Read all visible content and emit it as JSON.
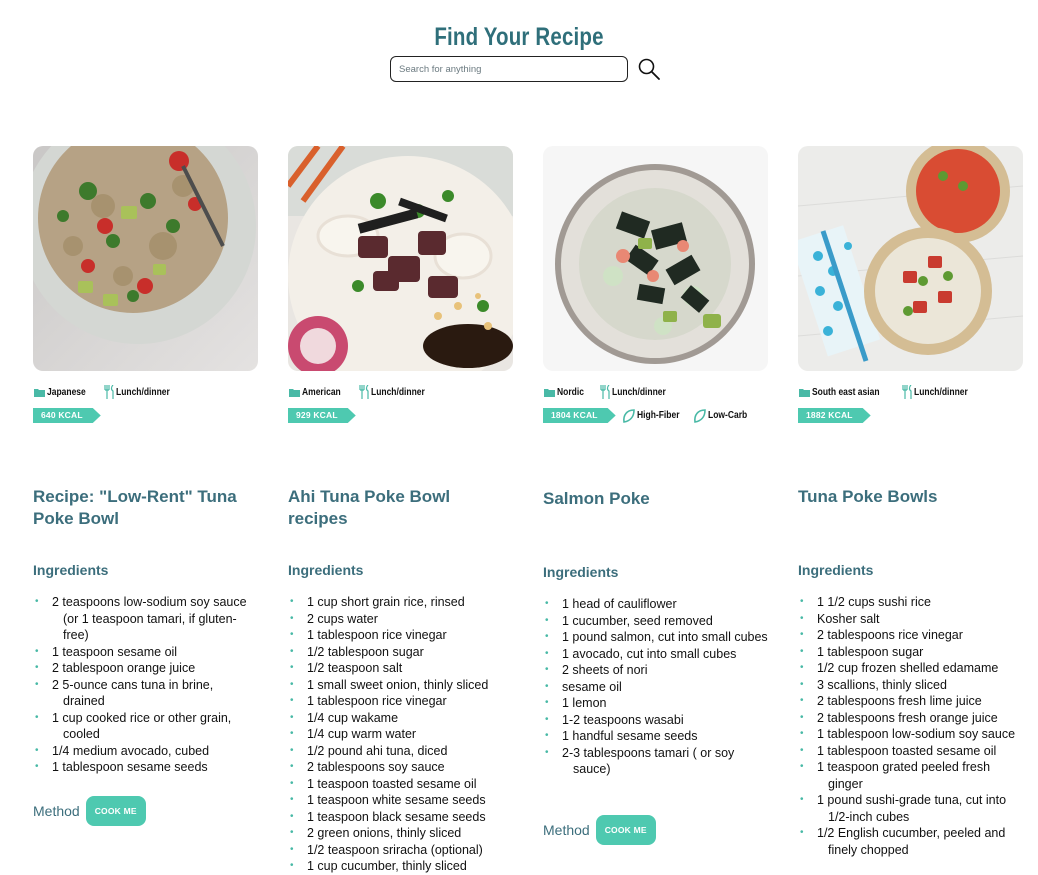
{
  "header": {
    "title": "Find Your Recipe"
  },
  "search": {
    "placeholder": "Search for anything"
  },
  "labels": {
    "ingredients": "Ingredients",
    "method": "Method",
    "cook_button": "COOK ME"
  },
  "colors": {
    "accent": "#4ec9b0",
    "heading": "#3c6e7c",
    "title": "#2f6f7a"
  },
  "recipes": [
    {
      "cuisine": "Japanese",
      "meal": "Lunch/dinner",
      "kcal": "640 KCAL",
      "diet": [],
      "title": "Recipe: \"Low-Rent\" Tuna Poke Bowl",
      "ingredients": [
        "2 teaspoons low-sodium soy sauce (or 1 teaspoon tamari, if gluten-free)",
        "1 teaspoon sesame oil",
        "2 tablespoon orange juice",
        "2 5-ounce cans tuna in brine, drained",
        "1 cup cooked rice or other grain, cooled",
        "1/4 medium avocado, cubed",
        "1 tablespoon sesame seeds"
      ]
    },
    {
      "cuisine": "American",
      "meal": "Lunch/dinner",
      "kcal": "929 KCAL",
      "diet": [],
      "title": "Ahi Tuna Poke Bowl recipes",
      "ingredients": [
        "1 cup short grain rice, rinsed",
        "2 cups water",
        "1 tablespoon rice vinegar",
        "1/2 tablespoon sugar",
        "1/2 teaspoon salt",
        "1 small sweet onion, thinly sliced",
        "1 tablespoon rice vinegar",
        "1/4 cup wakame",
        "1/4 cup warm water",
        "1/2 pound ahi tuna, diced",
        "2 tablespoons soy sauce",
        "1 teaspoon toasted sesame oil",
        "1 teaspoon white sesame seeds",
        "1 teaspoon black sesame seeds",
        "2 green onions, thinly sliced",
        "1/2 teaspoon sriracha (optional)",
        "1 cup cucumber, thinly sliced"
      ]
    },
    {
      "cuisine": "Nordic",
      "meal": "Lunch/dinner",
      "kcal": "1804 KCAL",
      "diet": [
        "High-Fiber",
        "Low-Carb"
      ],
      "title": "Salmon Poke",
      "ingredients": [
        "1 head of cauliflower",
        "1 cucumber, seed removed",
        "1 pound salmon, cut into small cubes",
        "1 avocado, cut into small cubes",
        "2 sheets of nori",
        "sesame oil",
        "1 lemon",
        "1-2 teaspoons wasabi",
        "1 handful sesame seeds",
        "2-3 tablespoons tamari ( or soy sauce)"
      ]
    },
    {
      "cuisine": "South east asian",
      "meal": "Lunch/dinner",
      "kcal": "1882 KCAL",
      "diet": [],
      "title": "Tuna Poke Bowls",
      "ingredients": [
        "1 1/2 cups sushi rice",
        "Kosher salt",
        "2 tablespoons rice vinegar",
        "1 tablespoon sugar",
        "1/2 cup frozen shelled edamame",
        "3 scallions, thinly sliced",
        "2 tablespoons fresh lime juice",
        "2 tablespoons fresh orange juice",
        "1 tablespoon low-sodium soy sauce",
        "1 tablespoon toasted sesame oil",
        "1 teaspoon grated peeled fresh ginger",
        "1 pound sushi-grade tuna, cut into 1/2-inch cubes",
        "1/2 English cucumber, peeled and finely chopped"
      ]
    }
  ]
}
